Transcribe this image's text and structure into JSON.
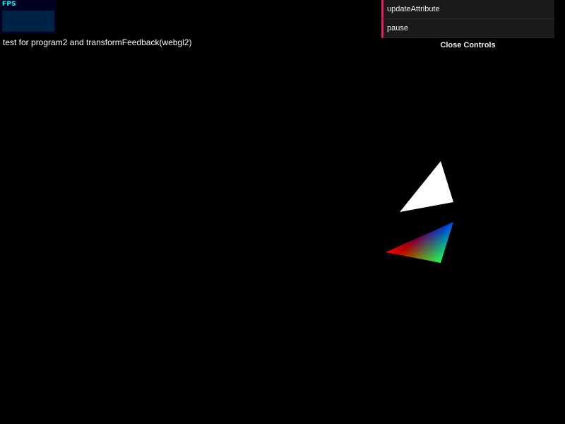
{
  "fps": {
    "label": "FPS"
  },
  "caption": "test for program2 and transformFeedback(webgl2)",
  "controls": {
    "items": [
      {
        "label": "updateAttribute"
      },
      {
        "label": "pause"
      }
    ],
    "close_label": "Close Controls"
  },
  "colors": {
    "background": "#000000",
    "gui_accent": "#e61d5f",
    "gui_row_bg": "#1a1a1a",
    "fps_text": "#00ffff",
    "fps_bg": "#000022",
    "fps_graph": "#002244",
    "triangle_plain": "#ffffff",
    "vertex_red": "#ff0000",
    "vertex_green": "#00ff00",
    "vertex_blue": "#0000ff"
  }
}
